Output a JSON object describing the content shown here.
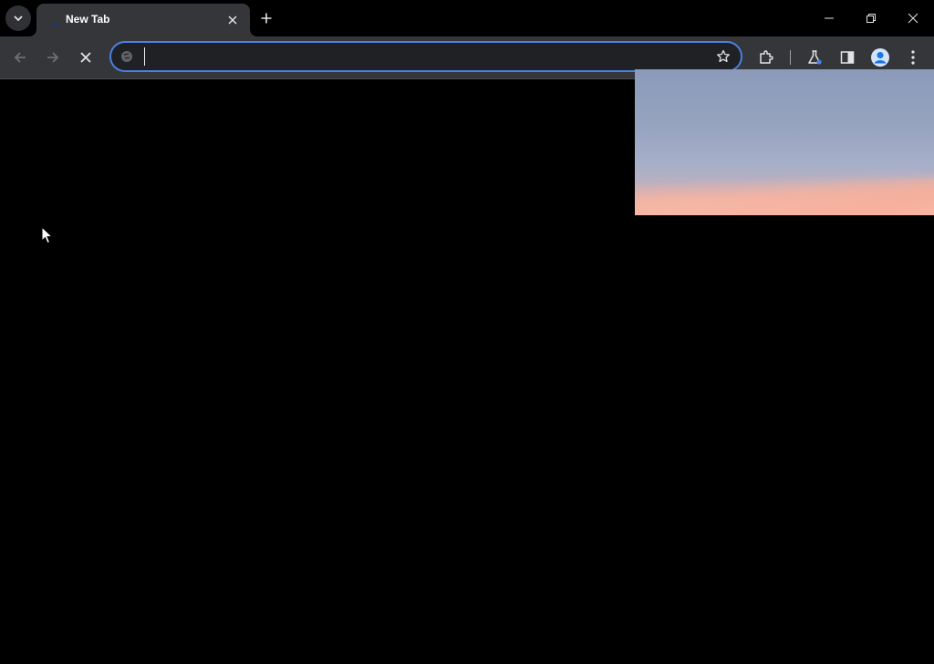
{
  "window": {
    "tabs": [
      {
        "title": "New Tab",
        "active": true
      }
    ]
  },
  "toolbar": {
    "address_value": "",
    "address_placeholder": ""
  },
  "icons": {
    "tab_search": "chevron-down-icon",
    "tab_close": "close-icon",
    "new_tab": "plus-icon",
    "minimize": "minimize-icon",
    "restore": "restore-icon",
    "close_window": "close-icon",
    "back": "arrow-left-icon",
    "forward": "arrow-right-icon",
    "stop": "close-icon",
    "site_info": "site-info-icon",
    "bookmark": "star-icon",
    "extensions": "puzzle-icon",
    "labs": "flask-icon",
    "side_panel": "side-panel-icon",
    "profile": "avatar-icon",
    "menu": "more-vertical-icon"
  },
  "colors": {
    "accent": "#4b80e0",
    "tab_bg": "#35363a",
    "frame_bg": "#000000"
  }
}
